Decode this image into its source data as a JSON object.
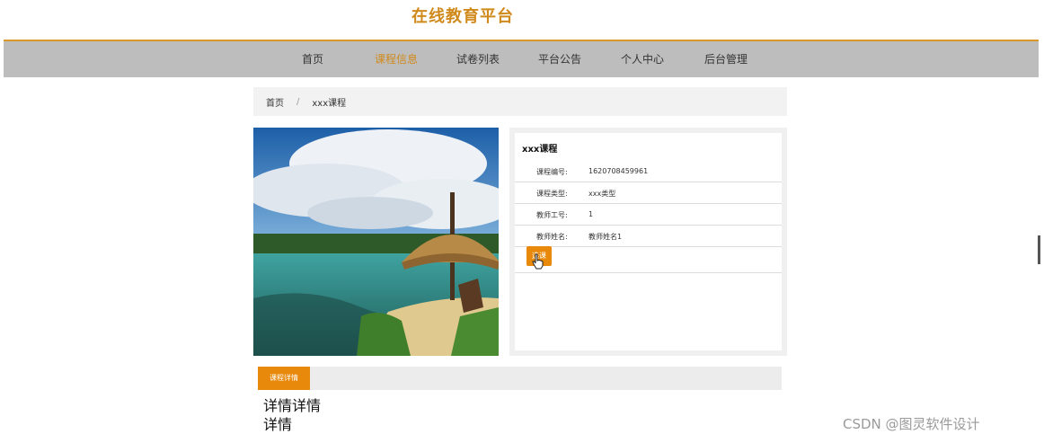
{
  "header": {
    "site_title": "在线教育平台"
  },
  "nav": {
    "items": [
      {
        "label": "首页"
      },
      {
        "label": "课程信息",
        "active": true
      },
      {
        "label": "试卷列表"
      },
      {
        "label": "平台公告"
      },
      {
        "label": "个人中心"
      },
      {
        "label": "后台管理"
      }
    ]
  },
  "breadcrumb": {
    "home": "首页",
    "separator": "/",
    "current": "xxx课程"
  },
  "course": {
    "name": "xxx课程",
    "fields": [
      {
        "label": "课程编号:",
        "value": "1620708459961"
      },
      {
        "label": "课程类型:",
        "value": "xxx类型"
      },
      {
        "label": "教师工号:",
        "value": "1"
      },
      {
        "label": "教师姓名:",
        "value": "教师姓名1"
      }
    ],
    "enroll_label": "选课"
  },
  "detail": {
    "tab_label": "课程详情",
    "lines": [
      "详情详情",
      "详情"
    ]
  },
  "watermark": "CSDN @图灵软件设计",
  "colors": {
    "accent": "#e8890b",
    "title": "#d08a1c",
    "nav_bg": "#bdbdbd"
  }
}
